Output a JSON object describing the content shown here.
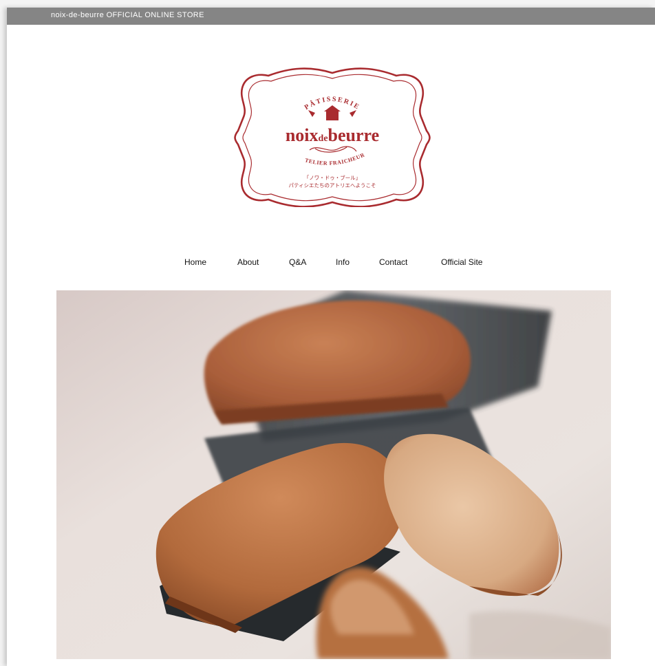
{
  "topbar": {
    "store_title": "noix-de-beurre OFFICIAL ONLINE STORE"
  },
  "logo": {
    "arc_text": "PÂTISSERIE",
    "brand_main": "noix",
    "brand_small": "de",
    "brand_end": "beurre",
    "subtitle": "ATELIER FRAICHEUR",
    "jp_line1": "「ノワ・ドゥ・ブール」",
    "jp_line2": "パティシエたちのアトリエへようこそ",
    "color": "#a92b2f"
  },
  "nav": {
    "items": [
      {
        "label": "Home"
      },
      {
        "label": "About"
      },
      {
        "label": "Q&A"
      },
      {
        "label": "Info"
      },
      {
        "label": "Contact"
      },
      {
        "label": "Official Site"
      }
    ]
  },
  "hero": {
    "description_icon": "financier-pastries-photo"
  },
  "colors": {
    "topbar": "#858585",
    "brand_red": "#a92b2f",
    "background": "#ffffff"
  }
}
